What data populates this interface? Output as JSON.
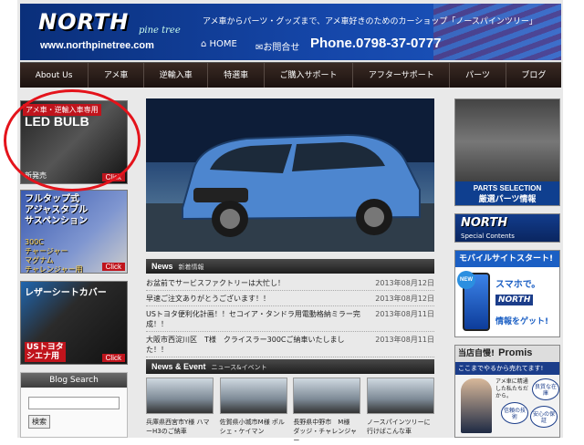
{
  "header": {
    "logo": "NORTH",
    "logo_script": "pine tree",
    "url": "www.northpinetree.com",
    "tagline": "アメ車からパーツ・グッズまで、アメ車好きのためのカーショップ「ノースパインツリー」",
    "home": "HOME",
    "contact": "お問合せ",
    "phone": "Phone.0798-37-0777"
  },
  "nav": [
    "About Us",
    "アメ車",
    "逆輸入車",
    "特選車",
    "ご購入サポート",
    "アフターサポート",
    "パーツ",
    "ブログ"
  ],
  "left_banners": {
    "led": {
      "tag": "アメ車・逆輸入車専用",
      "title": "LED BULB",
      "new": "新発売",
      "click": "Click"
    },
    "suspension": {
      "line1": "フルタップ式",
      "line2": "アジャスタブル",
      "line3": "サスペンション",
      "line4": "300C",
      "line5": "チャージャー",
      "line6": "マグナム",
      "line7": "チャレンジャー用",
      "click": "Click"
    },
    "seat": {
      "title": "レザーシートカバー",
      "line1": "USトヨタ",
      "line2": "シエナ用",
      "click": "Click"
    }
  },
  "blog_search": {
    "title": "Blog Search",
    "button": "検索"
  },
  "news": {
    "title": "News",
    "subtitle": "新着情報",
    "items": [
      {
        "title": "お盆前でサービスファクトリーは大忙し！",
        "date": "2013年08月12日"
      },
      {
        "title": "早速ご注文ありがとうございます！！",
        "date": "2013年08月12日"
      },
      {
        "title": "USトヨタ便利化計画！！セコイア・タンドラ用電動格納ミラー完成！！",
        "date": "2013年08月11日"
      },
      {
        "title": "大阪市西淀川区　T様　クライスラー300Cご納車いたしました！！",
        "date": "2013年08月11日"
      }
    ]
  },
  "events": {
    "title": "News & Event",
    "subtitle": "ニュース&イベント",
    "items": [
      {
        "caption": "兵庫県西宮市Y様 ハマーH3のご納車"
      },
      {
        "caption": "佐賀県小城市M様 ポルシェ・ケイマン"
      },
      {
        "caption": "長野県中野市　M様　ダッジ・チャレンジャー"
      },
      {
        "caption": "ノースパインツリーに行けばこんな車"
      }
    ]
  },
  "right": {
    "parts": {
      "line1": "PARTS SELECTION",
      "line2": "厳選パーツ情報"
    },
    "special": {
      "logo": "NORTH",
      "sub": "Special Contents"
    },
    "mobile": {
      "head": "モバイルサイトスタート!",
      "new": "NEW",
      "line1": "スマホで。",
      "line2": "NORTH",
      "line3": "情報をゲット!"
    },
    "promise": {
      "head": "当店自慢!",
      "brand": "Promis",
      "bar": "ここまでやるから売れてます!",
      "quote": "アメ車に精通した私たちだから。",
      "badge1": "良質な在庫",
      "badge2": "信頼の技術",
      "badge3": "安心の保証"
    }
  },
  "colors": {
    "header_blue": "#1546a8",
    "nav_dark": "#2b1d18",
    "accent_red": "#c0141c",
    "highlight_circle": "#e4131b"
  }
}
